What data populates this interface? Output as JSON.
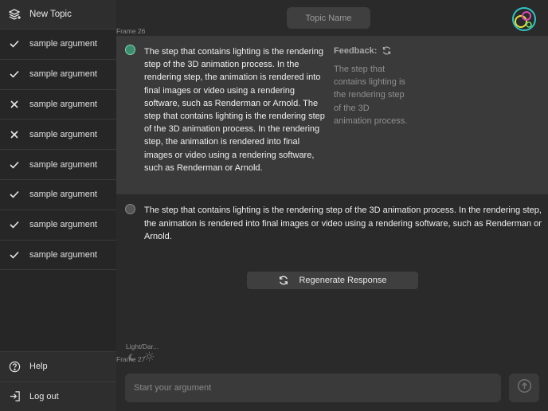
{
  "sidebar": {
    "new_topic": {
      "label": "New Topic",
      "icon": "layers-plus-icon"
    },
    "arguments": [
      {
        "label": "sample argument",
        "status": "check"
      },
      {
        "label": "sample argument",
        "status": "check"
      },
      {
        "label": "sample argument",
        "status": "cross"
      },
      {
        "label": "sample argument",
        "status": "cross"
      },
      {
        "label": "sample argument",
        "status": "check"
      },
      {
        "label": "sample argument",
        "status": "check"
      },
      {
        "label": "sample argument",
        "status": "check"
      },
      {
        "label": "sample argument",
        "status": "check"
      }
    ],
    "bottom": [
      {
        "label": "Help",
        "icon": "help-circle-icon"
      },
      {
        "label": "Log out",
        "icon": "logout-icon"
      }
    ]
  },
  "header": {
    "topic_name": "Topic Name"
  },
  "frame_labels": {
    "top": "Frame 26",
    "bottom": "Frame 27",
    "theme": "Light/Dar..."
  },
  "chat": {
    "user_message": "The step that contains lighting is the rendering step of the 3D animation process. In the rendering step, the animation is rendered into final images or video using a rendering software, such as Renderman or Arnold. The step that contains lighting is the rendering step of the 3D animation process. In the rendering step, the animation is rendered into final images or video using a rendering software, such as Renderman or Arnold.",
    "feedback_title": "Feedback:",
    "feedback_text": "The step that contains lighting is the rendering step of the 3D animation process.",
    "bot_message": "The step that contains lighting is the rendering step of the 3D animation process. In the rendering step, the animation is rendered into final images or video using a rendering software, such as Renderman or Arnold.",
    "regenerate_label": "Regenerate Response"
  },
  "input": {
    "placeholder": "Start your argument",
    "value": ""
  },
  "colors": {
    "background": "#2a2a2a",
    "sidebar": "#262626",
    "panel": "#3a3a3a",
    "accent_green": "#3b8e6d"
  }
}
